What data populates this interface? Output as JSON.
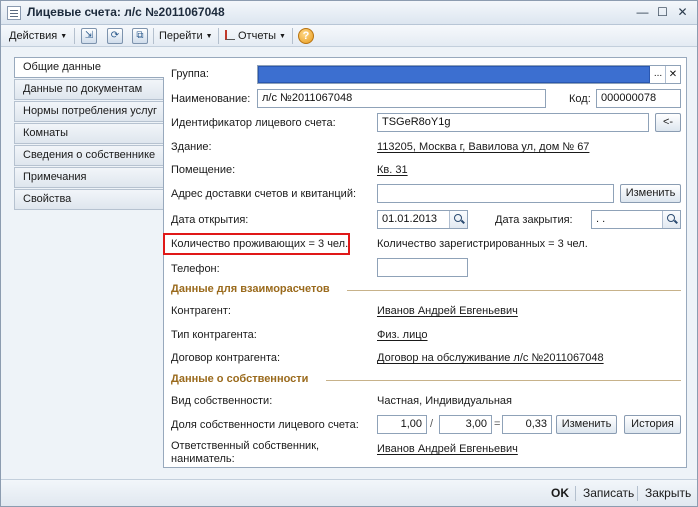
{
  "window": {
    "title": "Лицевые счета: л/с №2011067048",
    "min_glyph": "—",
    "max_glyph": "☐",
    "close_glyph": "✕"
  },
  "toolbar": {
    "actions_label": "Действия",
    "goto_label": "Перейти",
    "reports_label": "Отчеты",
    "help_glyph": "?"
  },
  "tabs": [
    {
      "label": "Общие данные",
      "active": true
    },
    {
      "label": "Данные по документам"
    },
    {
      "label": "Нормы потребления услуг"
    },
    {
      "label": "Комнаты"
    },
    {
      "label": "Сведения о собственнике"
    },
    {
      "label": "Примечания"
    },
    {
      "label": "Свойства"
    }
  ],
  "form": {
    "group_label": "Группа:",
    "group_dots": "...",
    "group_clear": "✕",
    "name_label": "Наименование:",
    "name_value": "л/с №2011067048",
    "code_label": "Код:",
    "code_value": "000000078",
    "account_id_label": "Идентификатор лицевого счета:",
    "account_id_value": "TSGeR8oY1g",
    "account_id_btn": "<-",
    "building_label": "Здание:",
    "building_value": "113205, Москва г, Вавилова ул, дом № 67",
    "premises_label": "Помещение:",
    "premises_value": "Кв. 31",
    "delivery_label": "Адрес доставки счетов и квитанций:",
    "delivery_value": "",
    "change_btn": "Изменить",
    "open_date_label": "Дата открытия:",
    "open_date_value": "01.01.2013",
    "close_date_label": "Дата закрытия:",
    "close_date_value": " .  .",
    "residents_label": "Количество проживающих = 3 чел.",
    "registered_label": "Количество зарегистрированных = 3 чел.",
    "phone_label": "Телефон:",
    "phone_value": ""
  },
  "settlements": {
    "title": "Данные для взаиморасчетов",
    "contractor_label": "Контрагент:",
    "contractor_value": "Иванов Андрей Евгеньевич",
    "contractor_type_label": "Тип контрагента:",
    "contractor_type_value": "Физ. лицо",
    "contract_label": "Договор контрагента:",
    "contract_value": "Договор на обслуживание л/с №2011067048"
  },
  "ownership": {
    "title": "Данные о собственности",
    "kind_label": "Вид собственности:",
    "kind_value": "Частная, Индивидуальная",
    "share_label": "Доля собственности лицевого счета:",
    "share_num": "1,00",
    "share_slash": "/",
    "share_den": "3,00",
    "share_eq": "=",
    "share_result": "0,33",
    "change_btn": "Изменить",
    "history_btn": "История",
    "owner_label_line1": "Ответственный собственник,",
    "owner_label_line2": "наниматель:",
    "owner_value": "Иванов Андрей Евгеньевич"
  },
  "bottom": {
    "ok": "OK",
    "save": "Записать",
    "close": "Закрыть"
  },
  "colors": {
    "accent_section": "#9a6a1c",
    "selection": "#3c6fd0",
    "highlight": "#e01818"
  }
}
